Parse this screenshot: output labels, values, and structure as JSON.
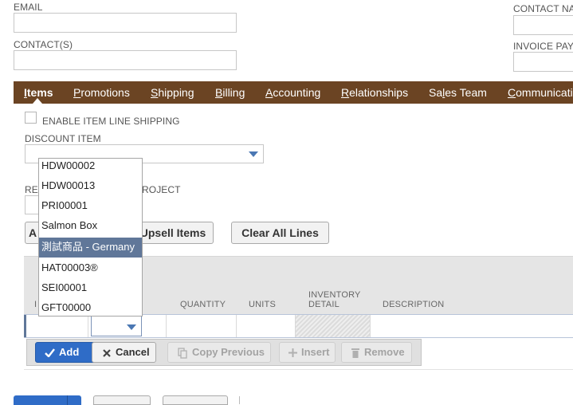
{
  "form": {
    "email_label": "EMAIL",
    "contacts_label": "CONTACT(S)",
    "contact_name_label": "CONTACT NA",
    "invoice_pay_label": "INVOICE PAY"
  },
  "tabs": [
    {
      "first": "I",
      "rest": "tems"
    },
    {
      "first": "P",
      "rest": "romotions"
    },
    {
      "first": "S",
      "rest": "hipping"
    },
    {
      "first": "B",
      "rest": "illing"
    },
    {
      "first": "A",
      "rest": "ccounting"
    },
    {
      "first": "R",
      "rest": "elationships"
    },
    {
      "first": "Sa",
      "u": "l",
      "rest": "es Team"
    },
    {
      "first": "C",
      "rest": "ommunicati"
    }
  ],
  "items_tab": {
    "enable_shipping_label": "ENABLE ITEM LINE SHIPPING",
    "discount_item_label": "DISCOUNT ITEM",
    "re_label_partial": "RE",
    "project_label_partial": "ROJECT",
    "a_button_partial": "A",
    "upsell_button": "Upsell Items",
    "clear_button": "Clear All Lines"
  },
  "dropdown": {
    "options": [
      "HDW00002",
      "HDW00013",
      "PRI00001",
      "Salmon Box",
      "測試商品 - Germany",
      "HAT00003®",
      "SEI00001",
      "GFT00000"
    ],
    "selected_index": 4
  },
  "grid": {
    "columns": {
      "partial_col": "I",
      "quantity": "QUANTITY",
      "units": "UNITS",
      "inventory_line1": "INVENTORY",
      "inventory_line2": "DETAIL",
      "description": "DESCRIPTION"
    }
  },
  "actions": {
    "add": "Add",
    "cancel": "Cancel",
    "copy_previous": "Copy Previous",
    "insert": "Insert",
    "remove": "Remove"
  },
  "colors": {
    "tab_bar": "#6b4423",
    "selected_option": "#607799",
    "primary_button": "#2f6cc7"
  }
}
